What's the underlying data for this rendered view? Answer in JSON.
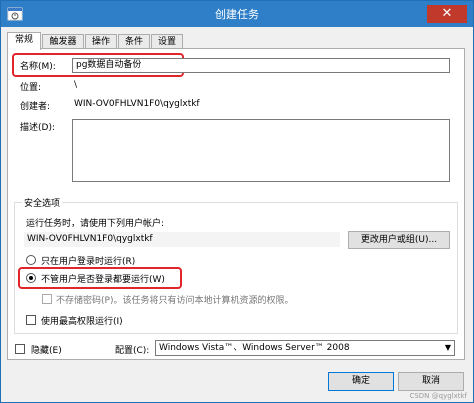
{
  "window": {
    "title": "创建任务",
    "close_glyph": "✕"
  },
  "tabs": [
    {
      "label": "常规",
      "active": true
    },
    {
      "label": "触发器"
    },
    {
      "label": "操作"
    },
    {
      "label": "条件"
    },
    {
      "label": "设置"
    }
  ],
  "general": {
    "name_label": "名称(M):",
    "name_value": "pg数据自动备份",
    "location_label": "位置:",
    "location_value": "\\",
    "author_label": "创建者:",
    "author_value": "WIN-OV0FHLVN1F0\\qyglxtkf",
    "description_label": "描述(D):",
    "description_value": ""
  },
  "security": {
    "group_title": "安全选项",
    "run_as_label": "运行任务时，请使用下列用户帐户:",
    "run_as_value": "WIN-OV0FHLVN1F0\\qyglxtkf",
    "change_button": "更改用户或组(U)...",
    "radio_logged_on": "只在用户登录时运行(R)",
    "radio_whether": "不管用户是否登录都要运行(W)",
    "selected_option": "whether",
    "no_store_password": "不存储密码(P)。该任务将只有访问本地计算机资源的权限。",
    "highest_privileges": "使用最高权限运行(I)"
  },
  "bottom": {
    "hidden_label": "隐藏(E)",
    "configure_label": "配置(C):",
    "configure_value": "Windows Vista™、Windows Server™ 2008"
  },
  "buttons": {
    "ok": "确定",
    "cancel": "取消"
  },
  "watermark": "CSDN @qyglxtkf",
  "colors": {
    "titlebar": "#2f7fc8",
    "highlight": "#e0262b"
  }
}
